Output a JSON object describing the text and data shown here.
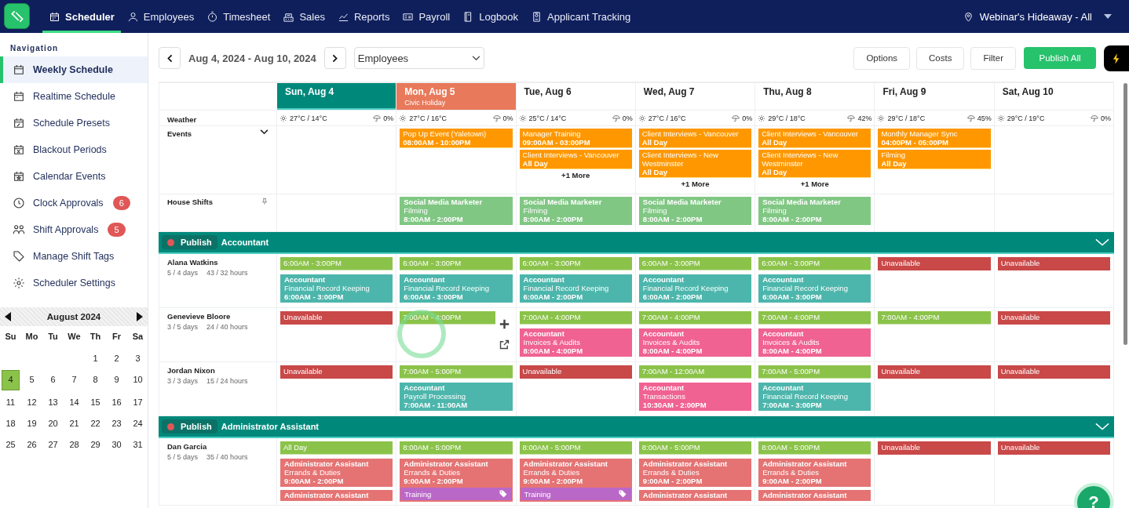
{
  "nav": {
    "items": [
      {
        "label": "Scheduler",
        "selected": true
      },
      {
        "label": "Employees",
        "selected": false
      },
      {
        "label": "Timesheet",
        "selected": false
      },
      {
        "label": "Sales",
        "selected": false
      },
      {
        "label": "Reports",
        "selected": false
      },
      {
        "label": "Payroll",
        "selected": false
      },
      {
        "label": "Logbook",
        "selected": false
      },
      {
        "label": "Applicant Tracking",
        "selected": false
      }
    ],
    "location": "Webinar's Hideaway - All"
  },
  "sidebar": {
    "heading": "Navigation",
    "items": [
      {
        "label": "Weekly Schedule",
        "selected": true
      },
      {
        "label": "Realtime Schedule",
        "selected": false
      },
      {
        "label": "Schedule Presets",
        "selected": false
      },
      {
        "label": "Blackout Periods",
        "selected": false
      },
      {
        "label": "Calendar Events",
        "selected": false
      },
      {
        "label": "Clock Approvals",
        "selected": false,
        "badge": "6"
      },
      {
        "label": "Shift Approvals",
        "selected": false,
        "badge": "5"
      },
      {
        "label": "Manage Shift Tags",
        "selected": false
      },
      {
        "label": "Scheduler Settings",
        "selected": false
      }
    ]
  },
  "mini_calendar": {
    "month": "August 2024",
    "weekdays": [
      "Su",
      "Mo",
      "Tu",
      "We",
      "Th",
      "Fr",
      "Sa"
    ],
    "weeks": [
      [
        {
          "label": "1",
          "selected": false
        },
        {
          "label": "2",
          "selected": false
        },
        {
          "label": "3",
          "selected": false
        }
      ],
      [
        {
          "label": "4",
          "selected": true
        },
        {
          "label": "5",
          "selected": false
        },
        {
          "label": "6",
          "selected": false
        },
        {
          "label": "7",
          "selected": false
        },
        {
          "label": "8",
          "selected": false
        },
        {
          "label": "9",
          "selected": false
        },
        {
          "label": "10",
          "selected": false
        }
      ],
      [
        {
          "label": "11",
          "selected": false
        },
        {
          "label": "12",
          "selected": false
        },
        {
          "label": "13",
          "selected": false
        },
        {
          "label": "14",
          "selected": false
        },
        {
          "label": "15",
          "selected": false
        },
        {
          "label": "16",
          "selected": false
        },
        {
          "label": "17",
          "selected": false
        }
      ],
      [
        {
          "label": "18",
          "selected": false
        },
        {
          "label": "19",
          "selected": false
        },
        {
          "label": "20",
          "selected": false
        },
        {
          "label": "21",
          "selected": false
        },
        {
          "label": "22",
          "selected": false
        },
        {
          "label": "23",
          "selected": false
        },
        {
          "label": "24",
          "selected": false
        }
      ],
      [
        {
          "label": "25",
          "selected": false
        },
        {
          "label": "26",
          "selected": false
        },
        {
          "label": "27",
          "selected": false
        },
        {
          "label": "28",
          "selected": false
        },
        {
          "label": "29",
          "selected": false
        },
        {
          "label": "30",
          "selected": false
        },
        {
          "label": "31",
          "selected": false
        }
      ]
    ]
  },
  "toolbar": {
    "date_range": "Aug 4, 2024 - Aug 10, 2024",
    "view_select": "Employees",
    "buttons": [
      "Options",
      "Costs",
      "Filter"
    ],
    "publish_button": "Publish All"
  },
  "schedule": {
    "weather_label": "Weather",
    "events_label": "Events",
    "house_shifts_label": "House Shifts",
    "days": [
      {
        "label": "Sun, Aug 4",
        "selected": true,
        "weather": {
          "temp": "27°C / 14°C",
          "precip": "0%"
        }
      },
      {
        "label": "Mon, Aug 5",
        "selected": false,
        "holiday": "Civic Holiday",
        "weather": {
          "temp": "27°C / 16°C",
          "precip": "0%"
        },
        "events": [
          {
            "title": "Pop Up Event (Yaletown)",
            "time": "08:00AM - 10:00PM"
          }
        ],
        "house_shifts": [
          {
            "title": "Social Media Marketer",
            "task": "Filming",
            "time": "8:00AM - 2:00PM",
            "color": "#81c784"
          }
        ]
      },
      {
        "label": "Tue, Aug 6",
        "selected": false,
        "weather": {
          "temp": "25°C / 14°C",
          "precip": "0%"
        },
        "events": [
          {
            "title": "Manager Training",
            "time": "09:00AM - 03:00PM"
          },
          {
            "title": "Client Interviews - Vancouver",
            "time": "All Day"
          }
        ],
        "more": "+1 More",
        "house_shifts": [
          {
            "title": "Social Media Marketer",
            "task": "Filming",
            "time": "8:00AM - 2:00PM",
            "color": "#81c784"
          }
        ]
      },
      {
        "label": "Wed, Aug 7",
        "selected": false,
        "weather": {
          "temp": "27°C / 16°C",
          "precip": "0%"
        },
        "events": [
          {
            "title": "Client Interviews - Vancouver",
            "time": "All Day"
          },
          {
            "title": "Client Interviews - New Westminster",
            "time": "All Day"
          }
        ],
        "more": "+1 More",
        "house_shifts": [
          {
            "title": "Social Media Marketer",
            "task": "Filming",
            "time": "8:00AM - 2:00PM",
            "color": "#81c784"
          }
        ]
      },
      {
        "label": "Thu, Aug 8",
        "selected": false,
        "weather": {
          "temp": "29°C / 18°C",
          "precip": "42%"
        },
        "events": [
          {
            "title": "Client Interviews - Vancouver",
            "time": "All Day"
          },
          {
            "title": "Client Interviews - New Westminster",
            "time": "All Day"
          }
        ],
        "more": "+1 More",
        "house_shifts": [
          {
            "title": "Social Media Marketer",
            "task": "Filming",
            "time": "8:00AM - 2:00PM",
            "color": "#81c784"
          }
        ]
      },
      {
        "label": "Fri, Aug 9",
        "selected": false,
        "weather": {
          "temp": "29°C / 18°C",
          "precip": "45%"
        },
        "events": [
          {
            "title": "Monthly Manager Sync",
            "time": "04:00PM - 05:00PM"
          },
          {
            "title": "Filming",
            "time": "All Day"
          }
        ]
      },
      {
        "label": "Sat, Aug 10",
        "selected": false,
        "weather": {
          "temp": "29°C / 19°C",
          "precip": "0%"
        }
      }
    ]
  },
  "groups": [
    {
      "name": "Accountant",
      "publish": "Publish",
      "expanded": true,
      "employees": [
        {
          "name": "Alana Watkins",
          "days": "5 / 4 days",
          "hours": "43 / 32 hours",
          "cells": [
            {
              "hovered": false,
              "items": [
                {
                  "kind": "available",
                  "text": "6:00AM - 3:00PM"
                },
                {
                  "kind": "shift",
                  "title": "Accountant",
                  "task": "Financial Record Keeping",
                  "time": "6:00AM - 3:00PM",
                  "color": "#4db6ac"
                }
              ]
            },
            {
              "hovered": false,
              "items": [
                {
                  "kind": "available",
                  "text": "6:00AM - 3:00PM"
                },
                {
                  "kind": "shift",
                  "title": "Accountant",
                  "task": "Financial Record Keeping",
                  "time": "6:00AM - 3:00PM",
                  "color": "#4db6ac"
                }
              ]
            },
            {
              "hovered": false,
              "items": [
                {
                  "kind": "available",
                  "text": "6:00AM - 3:00PM"
                },
                {
                  "kind": "shift",
                  "title": "Accountant",
                  "task": "Financial Record Keeping",
                  "time": "6:00AM - 2:00PM",
                  "color": "#4db6ac"
                }
              ]
            },
            {
              "hovered": false,
              "items": [
                {
                  "kind": "available",
                  "text": "6:00AM - 3:00PM"
                },
                {
                  "kind": "shift",
                  "title": "Accountant",
                  "task": "Financial Record Keeping",
                  "time": "6:00AM - 2:00PM",
                  "color": "#4db6ac"
                }
              ]
            },
            {
              "hovered": false,
              "items": [
                {
                  "kind": "available",
                  "text": "6:00AM - 3:00PM"
                },
                {
                  "kind": "shift",
                  "title": "Accountant",
                  "task": "Financial Record Keeping",
                  "time": "6:00AM - 3:00PM",
                  "color": "#4db6ac"
                }
              ]
            },
            {
              "hovered": false,
              "items": [
                {
                  "kind": "unavailable",
                  "text": "Unavailable"
                }
              ]
            },
            {
              "hovered": false,
              "items": [
                {
                  "kind": "unavailable",
                  "text": "Unavailable"
                }
              ]
            }
          ]
        },
        {
          "name": "Genevieve Bloore",
          "days": "3 / 5 days",
          "hours": "24 / 40 hours",
          "cells": [
            {
              "hovered": false,
              "items": [
                {
                  "kind": "unavailable",
                  "text": "Unavailable"
                }
              ]
            },
            {
              "hovered": true,
              "items": [
                {
                  "kind": "available",
                  "text": "7:00AM - 4:00PM"
                }
              ]
            },
            {
              "hovered": false,
              "items": [
                {
                  "kind": "available",
                  "text": "7:00AM - 4:00PM"
                },
                {
                  "kind": "shift",
                  "title": "Accountant",
                  "task": "Invoices & Audits",
                  "time": "8:00AM - 4:00PM",
                  "color": "#f06292"
                }
              ]
            },
            {
              "hovered": false,
              "items": [
                {
                  "kind": "available",
                  "text": "7:00AM - 4:00PM"
                },
                {
                  "kind": "shift",
                  "title": "Accountant",
                  "task": "Invoices & Audits",
                  "time": "8:00AM - 4:00PM",
                  "color": "#f06292"
                }
              ]
            },
            {
              "hovered": false,
              "items": [
                {
                  "kind": "available",
                  "text": "7:00AM - 4:00PM"
                },
                {
                  "kind": "shift",
                  "title": "Accountant",
                  "task": "Invoices & Audits",
                  "time": "8:00AM - 4:00PM",
                  "color": "#f06292"
                }
              ]
            },
            {
              "hovered": false,
              "items": [
                {
                  "kind": "available",
                  "text": "7:00AM - 4:00PM"
                }
              ]
            },
            {
              "hovered": false,
              "items": [
                {
                  "kind": "unavailable",
                  "text": "Unavailable"
                }
              ]
            }
          ]
        },
        {
          "name": "Jordan Nixon",
          "days": "3 / 3 days",
          "hours": "15 / 24 hours",
          "cells": [
            {
              "hovered": false,
              "items": [
                {
                  "kind": "unavailable",
                  "text": "Unavailable"
                }
              ]
            },
            {
              "hovered": false,
              "items": [
                {
                  "kind": "available",
                  "text": "7:00AM - 5:00PM"
                },
                {
                  "kind": "shift",
                  "title": "Accountant",
                  "task": "Payroll Processing",
                  "time": "7:00AM - 11:00AM",
                  "color": "#4db6ac"
                }
              ]
            },
            {
              "hovered": false,
              "items": [
                {
                  "kind": "unavailable",
                  "text": "Unavailable"
                }
              ]
            },
            {
              "hovered": false,
              "items": [
                {
                  "kind": "available",
                  "text": "7:00AM - 12:00AM"
                },
                {
                  "kind": "shift",
                  "title": "Accountant",
                  "task": "Transactions",
                  "time": "10:30AM - 2:00PM",
                  "color": "#f06292"
                }
              ]
            },
            {
              "hovered": false,
              "items": [
                {
                  "kind": "available",
                  "text": "7:00AM - 5:00PM"
                },
                {
                  "kind": "shift",
                  "title": "Accountant",
                  "task": "Financial Record Keeping",
                  "time": "7:00AM - 3:00PM",
                  "color": "#4db6ac"
                }
              ]
            },
            {
              "hovered": false,
              "items": [
                {
                  "kind": "unavailable",
                  "text": "Unavailable"
                }
              ]
            },
            {
              "hovered": false,
              "items": [
                {
                  "kind": "unavailable",
                  "text": "Unavailable"
                }
              ]
            }
          ]
        }
      ]
    },
    {
      "name": "Administrator Assistant",
      "publish": "Publish",
      "expanded": true,
      "employees": [
        {
          "name": "Dan Garcia",
          "days": "5 / 5 days",
          "hours": "35 / 40 hours",
          "cells": [
            {
              "hovered": false,
              "items": [
                {
                  "kind": "available",
                  "text": "All Day"
                },
                {
                  "kind": "shift",
                  "title": "Administrator Assistant",
                  "task": "Errands & Duties",
                  "time": "9:00AM - 2:00PM",
                  "color": "#e57373"
                },
                {
                  "kind": "shift",
                  "title": "Administrator Assistant",
                  "color": "#e57373"
                }
              ]
            },
            {
              "hovered": false,
              "items": [
                {
                  "kind": "available",
                  "text": "8:00AM - 5:00PM"
                },
                {
                  "kind": "shift",
                  "title": "Administrator Assistant",
                  "task": "Errands & Duties",
                  "time": "9:00AM - 2:00PM",
                  "tag": "Training",
                  "color": "#e57373"
                }
              ]
            },
            {
              "hovered": false,
              "items": [
                {
                  "kind": "available",
                  "text": "8:00AM - 5:00PM"
                },
                {
                  "kind": "shift",
                  "title": "Administrator Assistant",
                  "task": "Errands & Duties",
                  "time": "9:00AM - 2:00PM",
                  "tag": "Training",
                  "color": "#e57373"
                }
              ]
            },
            {
              "hovered": false,
              "items": [
                {
                  "kind": "available",
                  "text": "8:00AM - 5:00PM"
                },
                {
                  "kind": "shift",
                  "title": "Administrator Assistant",
                  "task": "Errands & Duties",
                  "time": "9:00AM - 2:00PM",
                  "color": "#e57373"
                },
                {
                  "kind": "shift",
                  "title": "Administrator Assistant",
                  "color": "#e57373"
                }
              ]
            },
            {
              "hovered": false,
              "items": [
                {
                  "kind": "available",
                  "text": "8:00AM - 5:00PM"
                },
                {
                  "kind": "shift",
                  "title": "Administrator Assistant",
                  "task": "Errands & Duties",
                  "time": "9:00AM - 2:00PM",
                  "color": "#e57373"
                },
                {
                  "kind": "shift",
                  "title": "Administrator Assistant",
                  "color": "#e57373"
                }
              ]
            },
            {
              "hovered": false,
              "items": [
                {
                  "kind": "unavailable",
                  "text": "Unavailable"
                }
              ]
            },
            {
              "hovered": false,
              "items": [
                {
                  "kind": "unavailable",
                  "text": "Unavailable"
                }
              ]
            }
          ]
        }
      ]
    }
  ],
  "help": {
    "label": "?"
  }
}
